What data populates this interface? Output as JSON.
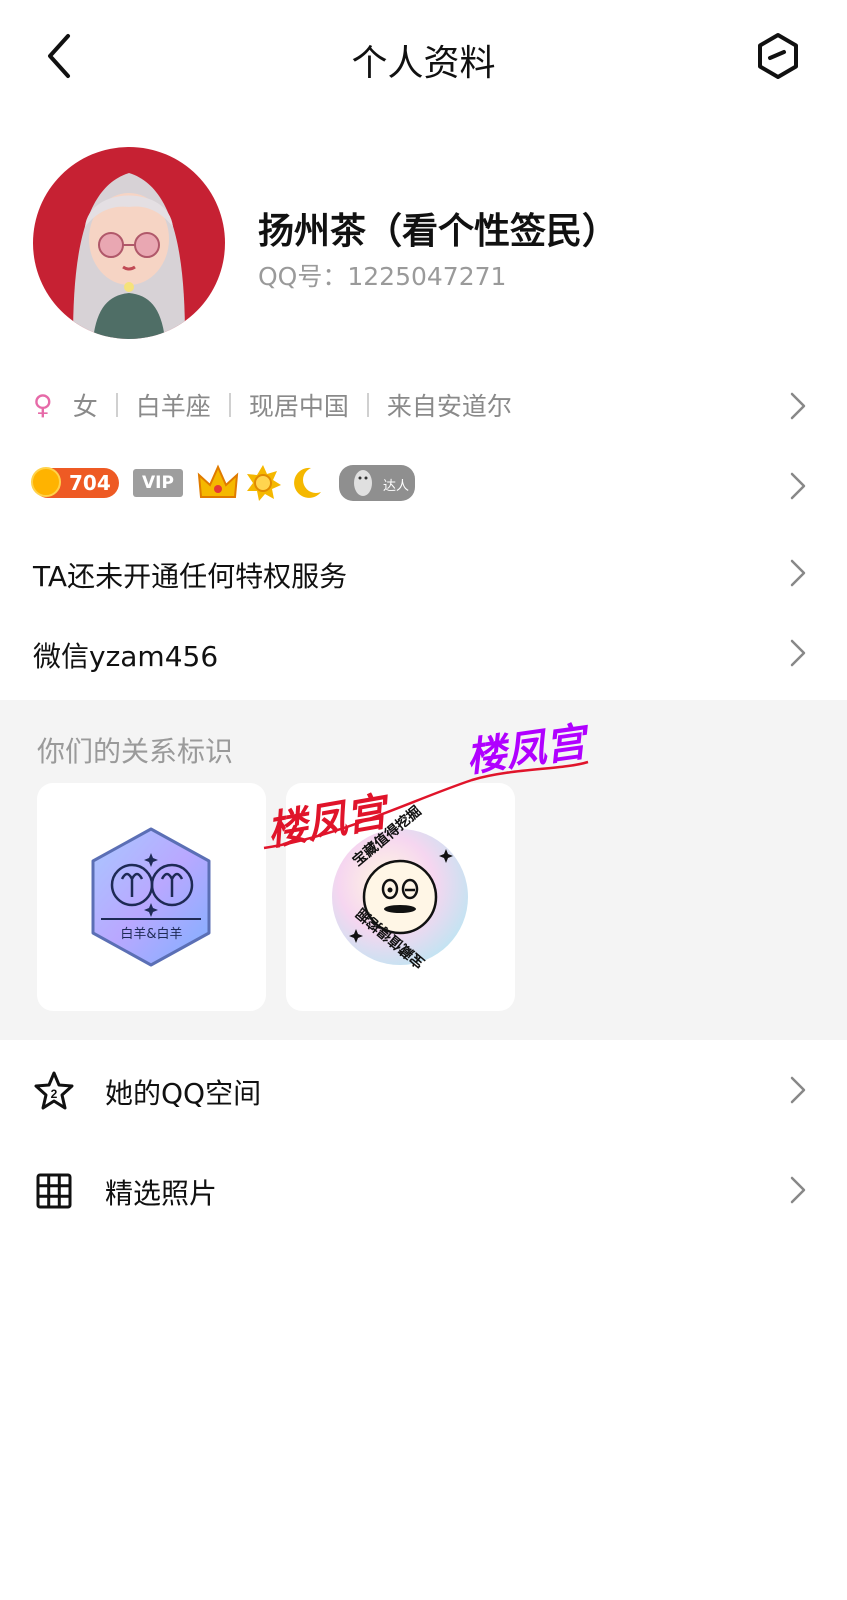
{
  "header": {
    "title": "个人资料",
    "back_icon": "chevron-left-icon",
    "more_icon": "hexagon-minus-icon"
  },
  "profile": {
    "nickname": "扬州茶（看个性签民）",
    "qq_label": "QQ号：1225047271"
  },
  "info": {
    "gender_icon": "♀",
    "gender": "女",
    "zodiac": "白羊座",
    "residence": "现居中国",
    "hometown": "来自安道尔"
  },
  "badges": {
    "level": "704",
    "vip": "VIP",
    "talent": "达人"
  },
  "privilege": {
    "label": "TA还未开通任何特权服务"
  },
  "wechat": {
    "label": "微信yzam456"
  },
  "relation": {
    "title": "你们的关系标识",
    "cards": [
      {
        "caption": "白羊&白羊"
      },
      {
        "ring_text": "宝藏值得挖掘"
      }
    ],
    "overlay_text": "楼凤宫"
  },
  "list": [
    {
      "icon": "star-number-icon",
      "label": "她的QQ空间"
    },
    {
      "icon": "grid-icon",
      "label": "精选照片"
    }
  ],
  "colors": {
    "accent_red": "#e53935",
    "overlay_purple": "#b000ff",
    "female_pink": "#e66aa8"
  }
}
